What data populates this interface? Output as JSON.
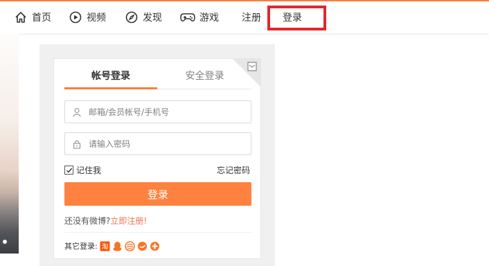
{
  "nav": {
    "items": [
      {
        "label": "首页",
        "icon": "home-icon"
      },
      {
        "label": "视频",
        "icon": "video-icon"
      },
      {
        "label": "发现",
        "icon": "compass-icon"
      },
      {
        "label": "游戏",
        "icon": "gamepad-icon"
      }
    ],
    "register": "注册",
    "login": "登录",
    "highlight_color": "#e3262b",
    "accent_color": "#fa7d3c"
  },
  "login_card": {
    "tabs": {
      "active": "帐号登录",
      "other": "安全登录"
    },
    "corner_icon": "qrcode-phone-icon",
    "username_placeholder": "邮箱/会员帐号/手机号",
    "password_placeholder": "请输入密码",
    "remember_me": "记住我",
    "remember_checked": true,
    "forgot_password": "忘记密码",
    "submit": "登录",
    "no_account": "还没有微博?",
    "register_link": "立即注册!",
    "other_login_label": "其它登录:",
    "other_login_icons": [
      "taobao-icon",
      "qq-icon",
      "tianyi-icon",
      "alipay-icon",
      "360-icon"
    ],
    "button_color": "#ff8140"
  }
}
